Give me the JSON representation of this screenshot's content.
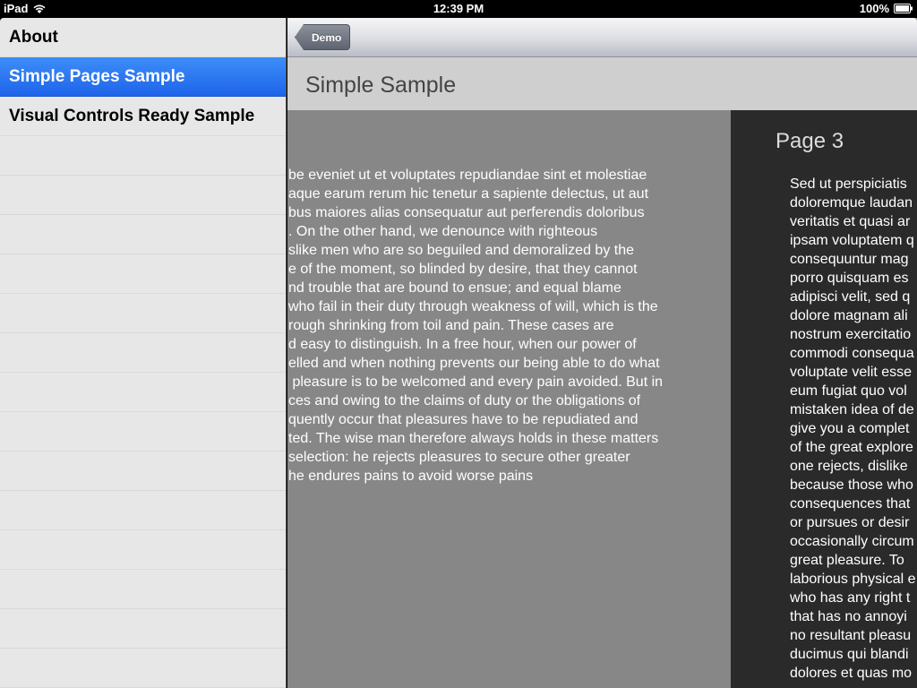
{
  "status": {
    "device": "iPad",
    "time": "12:39 PM",
    "battery": "100%"
  },
  "sidebar": {
    "items": [
      {
        "label": "About"
      },
      {
        "label": "Simple Pages Sample"
      },
      {
        "label": "Visual Controls Ready Sample"
      }
    ]
  },
  "navbar": {
    "back_label": "Demo"
  },
  "content": {
    "title": "Simple Sample",
    "page2_text": [
      "be eveniet ut et voluptates repudiandae sint et molestiae",
      "aque earum rerum hic tenetur a sapiente delectus, ut aut",
      "bus maiores alias consequatur aut perferendis doloribus",
      ". On the other hand, we denounce with righteous",
      "slike men who are so beguiled and demoralized by the",
      "e of the moment, so blinded by desire, that they cannot",
      "nd trouble that are bound to ensue; and equal blame",
      "who fail in their duty through weakness of will, which is the",
      "rough shrinking from toil and pain. These cases are",
      "d easy to distinguish. In a free hour, when our power of",
      "elled and when nothing prevents our being able to do what",
      " pleasure is to be welcomed and every pain avoided. But in",
      "ces and owing to the claims of duty or the obligations of",
      "quently occur that pleasures have to be repudiated and",
      "ted. The wise man therefore always holds in these matters",
      "selection: he rejects pleasures to secure other greater",
      "he endures pains to avoid worse pains"
    ],
    "page3": {
      "title": "Page 3",
      "text": [
        "Sed ut perspiciatis",
        "doloremque laudan",
        "veritatis et quasi ar",
        "ipsam voluptatem q",
        "consequuntur mag",
        "porro quisquam es",
        "adipisci velit, sed q",
        "dolore magnam ali",
        "nostrum exercitatio",
        "commodi consequa",
        "voluptate velit esse",
        "eum fugiat quo vol",
        "mistaken idea of de",
        "give you a complet",
        "of the great explore",
        "one rejects, dislike",
        "because those who",
        "consequences that",
        "or pursues or desir",
        "occasionally circum",
        "great pleasure. To",
        "laborious physical e",
        "who has any right t",
        "that has no annoyi",
        "no resultant pleasu",
        "ducimus qui blandi",
        "dolores et quas mo"
      ]
    }
  }
}
